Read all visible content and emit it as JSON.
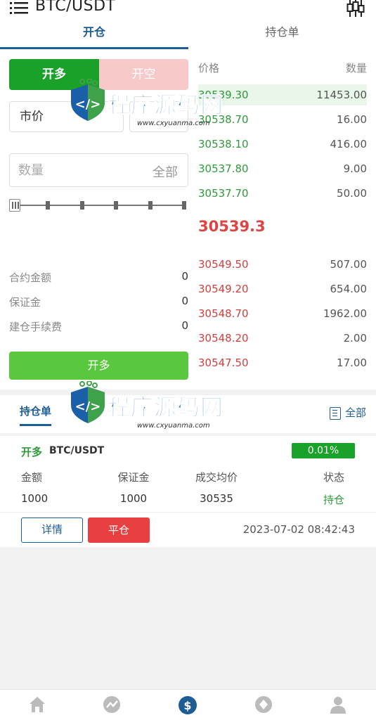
{
  "header": {
    "pair": "BTC/USDT"
  },
  "tabs": [
    {
      "label": "开仓"
    },
    {
      "label": "持仓单"
    }
  ],
  "order_form": {
    "long_label": "开多",
    "short_label": "开空",
    "order_type": "市价",
    "qty_placeholder": "数量",
    "qty_all": "全部",
    "info": [
      {
        "label": "合约金额",
        "value": "0"
      },
      {
        "label": "保证金",
        "value": "0"
      },
      {
        "label": "建仓手续费",
        "value": "0"
      }
    ],
    "submit_label": "开多"
  },
  "order_book": {
    "price_header": "价格",
    "qty_header": "数量",
    "buys": [
      {
        "price": "30539.30",
        "qty": "11453.00"
      },
      {
        "price": "30538.70",
        "qty": "16.00"
      },
      {
        "price": "30538.10",
        "qty": "416.00"
      },
      {
        "price": "30537.80",
        "qty": "9.00"
      },
      {
        "price": "30537.70",
        "qty": "50.00"
      }
    ],
    "last_price": "30539.3",
    "sells": [
      {
        "price": "30549.50",
        "qty": "507.00"
      },
      {
        "price": "30549.20",
        "qty": "654.00"
      },
      {
        "price": "30548.70",
        "qty": "1962.00"
      },
      {
        "price": "30548.20",
        "qty": "2.00"
      },
      {
        "price": "30547.50",
        "qty": "17.00"
      }
    ]
  },
  "positions": {
    "tab_label": "持仓单",
    "all_label": "全部",
    "item": {
      "side": "开多",
      "pair": "BTC/USDT",
      "pnl": "0.01%",
      "headers": [
        "金额",
        "保证金",
        "成交均价",
        "状态"
      ],
      "values": [
        "1000",
        "1000",
        "30535",
        "持仓"
      ],
      "detail_label": "详情",
      "close_label": "平仓",
      "time": "2023-07-02 08:42:43"
    }
  },
  "watermark": {
    "text": "程序源码网",
    "url": "www.cxyuanma.com"
  },
  "icons": {
    "menu": "menu-icon",
    "chart": "candlestick-icon",
    "list": "list-icon",
    "nav": [
      "home-icon",
      "market-icon",
      "trade-icon",
      "finance-icon",
      "user-icon"
    ]
  },
  "colors": {
    "green": "#19a12a",
    "red": "#e84040",
    "blue": "#1e5d94",
    "submit": "#5ac83e"
  }
}
